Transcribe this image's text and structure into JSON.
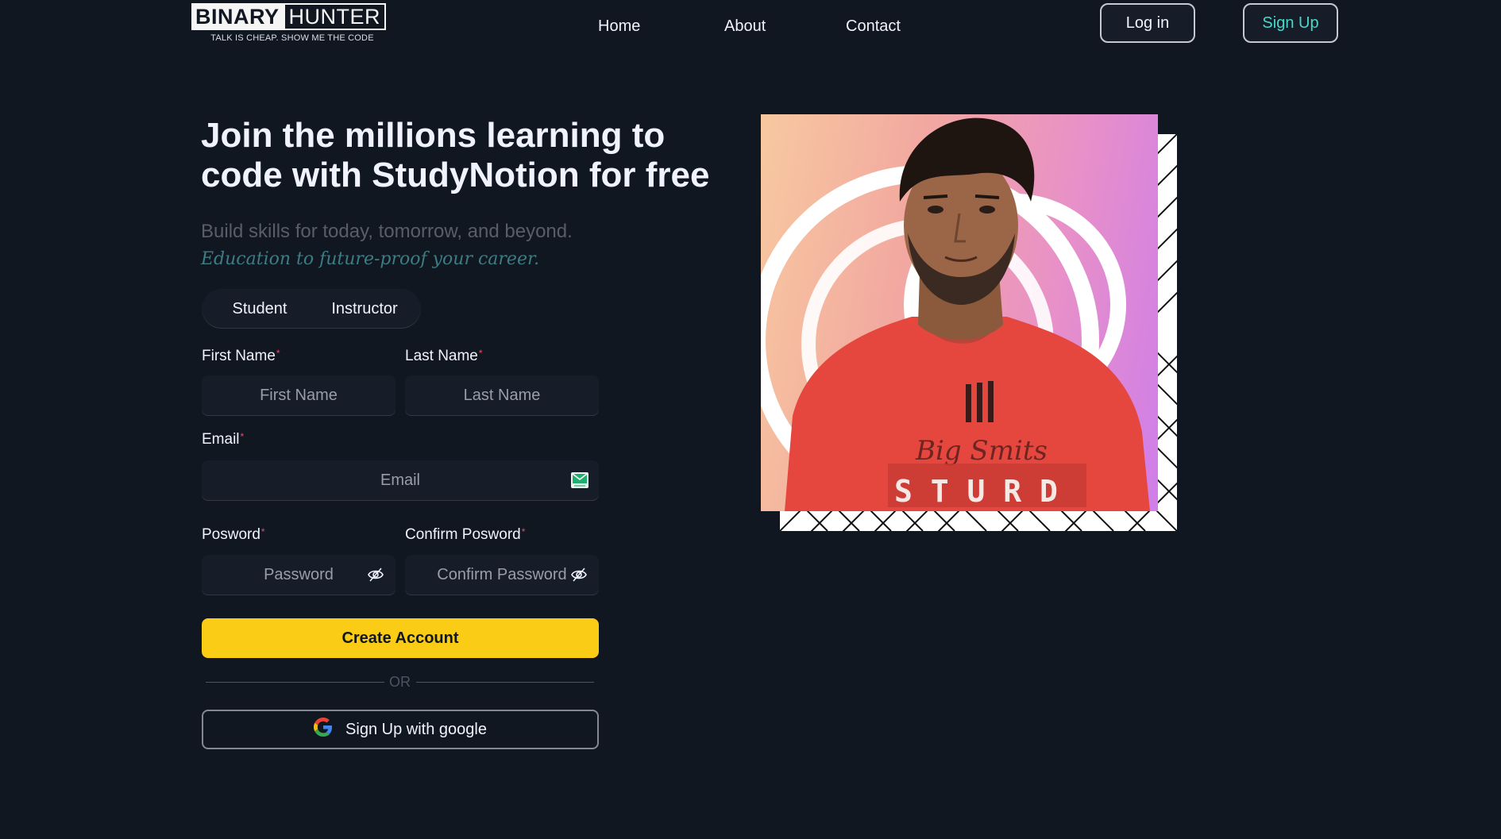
{
  "logo": {
    "word1": "BINARY",
    "word2": "HUNTER",
    "tagline": "TALK IS CHEAP. SHOW ME THE CODE"
  },
  "nav": {
    "links": [
      "Home",
      "About",
      "Contact"
    ],
    "login_label": "Log in",
    "signup_label": "Sign Up"
  },
  "hero": {
    "title": "Join the millions learning to code with StudyNotion for free",
    "subtitle": "Build skills for today, tomorrow, and beyond.",
    "highlight": "Education to future-proof your career."
  },
  "form": {
    "roles": [
      "Student",
      "Instructor"
    ],
    "first_name": {
      "label": "First Name",
      "placeholder": "First Name"
    },
    "last_name": {
      "label": "Last Name",
      "placeholder": "Last Name"
    },
    "email": {
      "label": "Email",
      "placeholder": "Email"
    },
    "password": {
      "label": "Posword",
      "placeholder": "Password"
    },
    "confirm_password": {
      "label": "Confirm Posword",
      "placeholder": "Confirm Password"
    },
    "required_mark": "*",
    "submit_label": "Create Account",
    "divider": "OR",
    "google_label": "Sign Up with google"
  },
  "photo": {
    "shirt_text": "S T U R D",
    "shirt_script": "Big Smits"
  },
  "colors": {
    "background": "#111720",
    "field": "#161d29",
    "accent_yellow": "#facc15",
    "accent_teal": "#47d8c8",
    "required": "#ef476f"
  },
  "icons": {
    "email": "email-icon",
    "password_toggle": "eye-slash-icon",
    "google": "google-icon"
  }
}
